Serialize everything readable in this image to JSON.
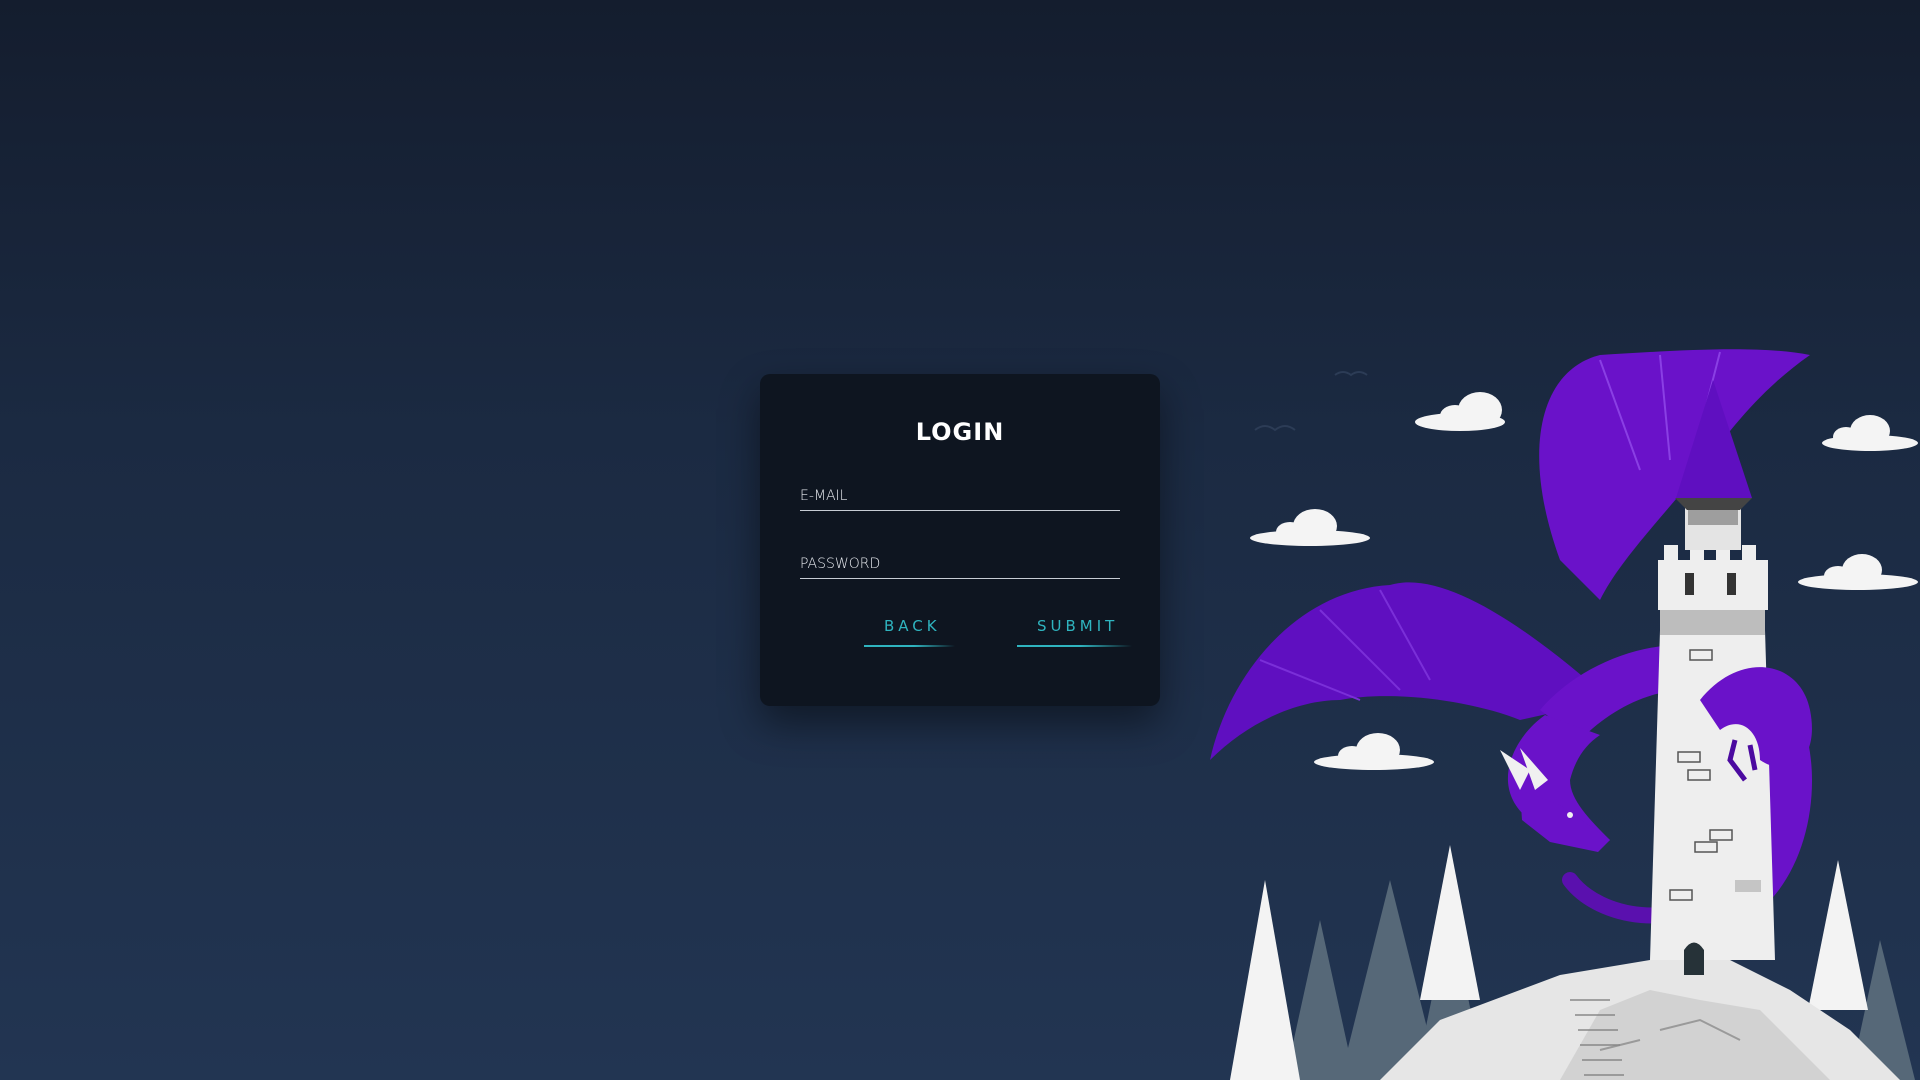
{
  "login": {
    "title": "LOGIN",
    "email_label": "E-MAIL",
    "password_label": "PASSWORD",
    "back_label": "BACK",
    "submit_label": "SUBMIT"
  },
  "colors": {
    "background_top": "#141d2e",
    "background_bottom": "#223552",
    "card": "#0e1520",
    "accent": "#2fb4bf",
    "dragon": "#6a12c9",
    "tower": "#ececec"
  },
  "illustration": {
    "subject": "purple-dragon-on-white-tower-icon"
  }
}
